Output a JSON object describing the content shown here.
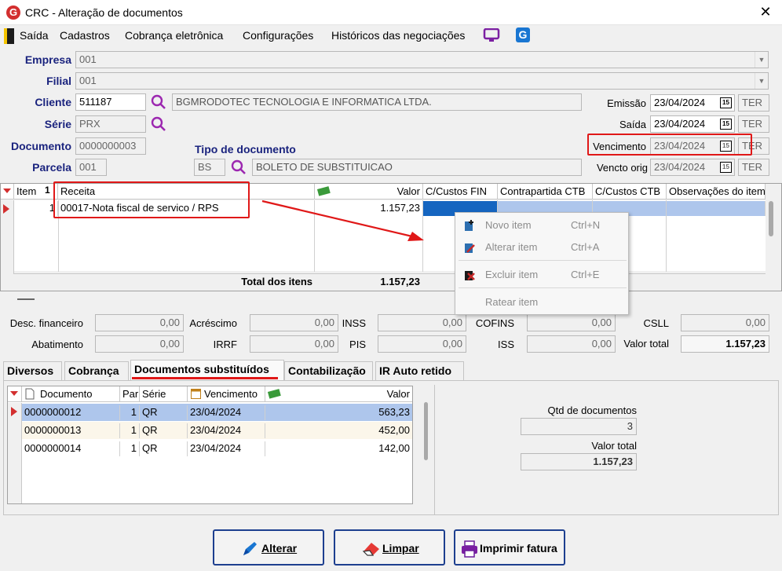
{
  "window": {
    "title": "CRC - Alteração de documentos",
    "app_icon": "G",
    "close": "✕"
  },
  "menu": [
    "Saída",
    "Cadastros",
    "Cobrança eletrônica",
    "Configurações",
    "Históricos das negociações"
  ],
  "form": {
    "empresa_label": "Empresa",
    "empresa_value": "001",
    "filial_label": "Filial",
    "filial_value": "001",
    "cliente_label": "Cliente",
    "cliente_code": "511187",
    "cliente_name": "BGMRODOTEC TECNOLOGIA E INFORMATICA LTDA.",
    "serie_label": "Série",
    "serie_value": "PRX",
    "documento_label": "Documento",
    "documento_value": "0000000003",
    "parcela_label": "Parcela",
    "parcela_value": "001",
    "tipo_label": "Tipo de documento",
    "tipo_code": "BS",
    "tipo_name": "BOLETO DE SUBSTITUICAO",
    "emissao_label": "Emissão",
    "emissao_value": "23/04/2024",
    "emissao_ter": "TER",
    "saida_label": "Saída",
    "saida_value": "23/04/2024",
    "saida_ter": "TER",
    "vencimento_label": "Vencimento",
    "vencimento_value": "23/04/2024",
    "vencimento_ter": "TER",
    "vencto_orig_label": "Vencto orig",
    "vencto_orig_value": "23/04/2024",
    "vencto_orig_ter": "TER",
    "calendar_glyph": "15"
  },
  "items_grid": {
    "headers": [
      "Item",
      "Receita",
      "Valor",
      "C/Custos FIN",
      "Contrapartida CTB",
      "C/Custos CTB",
      "Observações do item"
    ],
    "sort_glyph": "1",
    "rows": [
      {
        "item": "1",
        "receita": "00017-Nota fiscal de servico / RPS",
        "valor": "1.157,23"
      }
    ],
    "total_label": "Total dos itens",
    "total_value": "1.157,23"
  },
  "context_menu": [
    {
      "label": "Novo item",
      "shortcut": "Ctrl+N"
    },
    {
      "label": "Alterar item",
      "shortcut": "Ctrl+A"
    },
    {
      "label": "Excluir item",
      "shortcut": "Ctrl+E"
    },
    {
      "label": "Ratear item",
      "shortcut": ""
    }
  ],
  "totals": {
    "desc_financeiro": {
      "label": "Desc. financeiro",
      "value": "0,00"
    },
    "acrescimo": {
      "label": "Acréscimo",
      "value": "0,00"
    },
    "inss": {
      "label": "INSS",
      "value": "0,00"
    },
    "cofins": {
      "label": "COFINS",
      "value": "0,00"
    },
    "csll": {
      "label": "CSLL",
      "value": "0,00"
    },
    "abatimento": {
      "label": "Abatimento",
      "value": "0,00"
    },
    "irrf": {
      "label": "IRRF",
      "value": "0,00"
    },
    "pis": {
      "label": "PIS",
      "value": "0,00"
    },
    "iss": {
      "label": "ISS",
      "value": "0,00"
    },
    "valor_total": {
      "label": "Valor total",
      "value": "1.157,23"
    }
  },
  "tabs": [
    "Diversos",
    "Cobrança",
    "Documentos substituídos",
    "Contabilização",
    "IR Auto retido"
  ],
  "docs_grid": {
    "headers": [
      "Documento",
      "Par",
      "Série",
      "Vencimento",
      "Valor"
    ],
    "rows": [
      {
        "doc": "0000000012",
        "par": "1",
        "serie": "QR",
        "venc": "23/04/2024",
        "valor": "563,23"
      },
      {
        "doc": "0000000013",
        "par": "1",
        "serie": "QR",
        "venc": "23/04/2024",
        "valor": "452,00"
      },
      {
        "doc": "0000000014",
        "par": "1",
        "serie": "QR",
        "venc": "23/04/2024",
        "valor": "142,00"
      }
    ]
  },
  "summary": {
    "qtd_label": "Qtd de documentos",
    "qtd_value": "3",
    "valor_label": "Valor total",
    "valor_value": "1.157,23"
  },
  "buttons": {
    "alterar": "Alterar",
    "limpar": "Limpar",
    "imprimir": "Imprimir fatura"
  },
  "colors": {
    "accent": "#1a237e",
    "highlight_row": "#aec6ec",
    "annotation": "#e01818"
  }
}
